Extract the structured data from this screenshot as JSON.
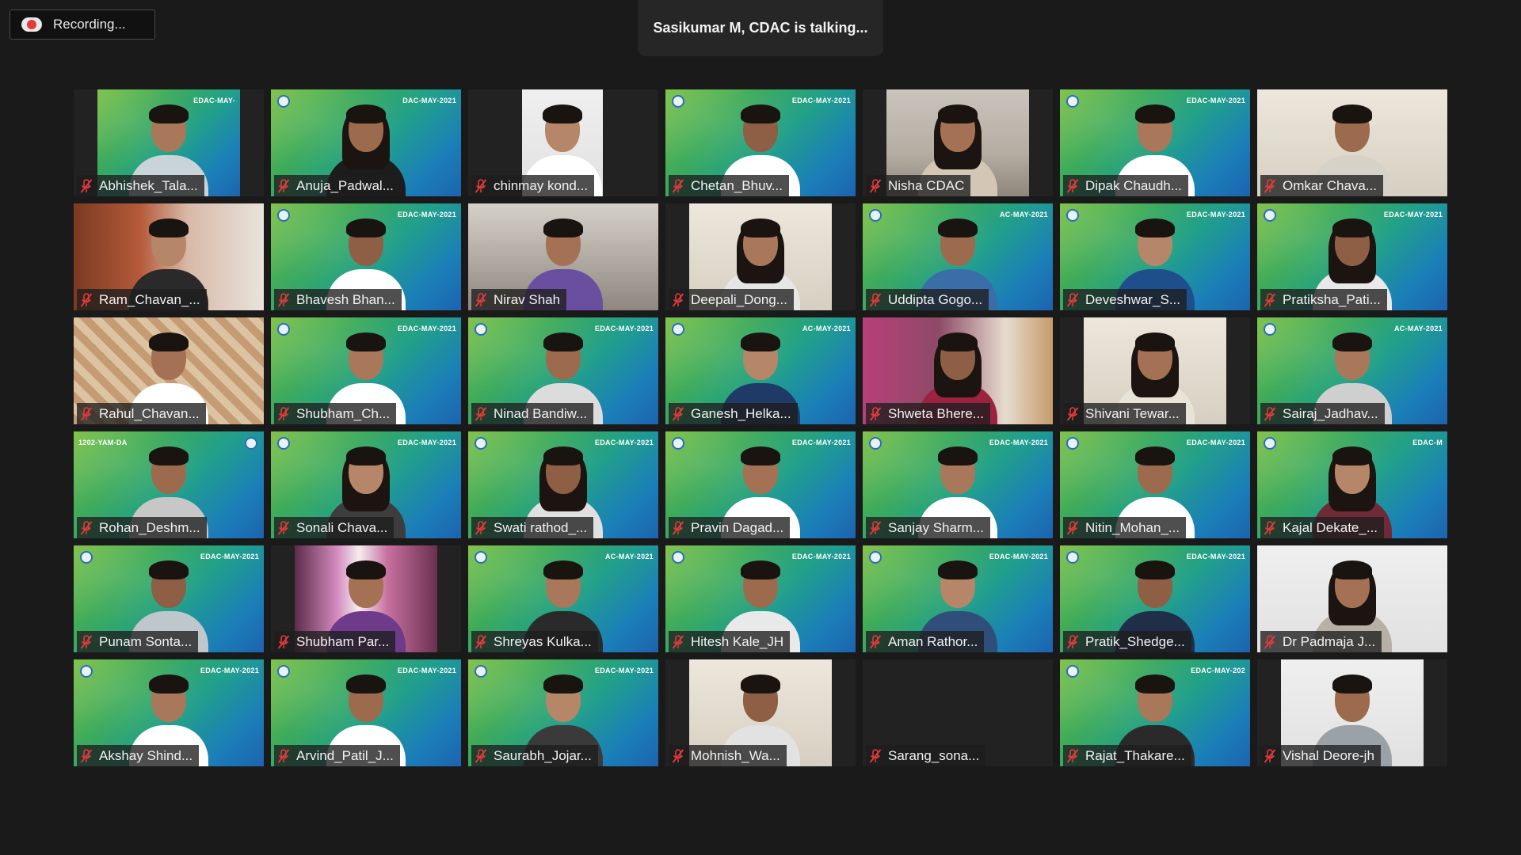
{
  "recording": {
    "label": "Recording..."
  },
  "talking": {
    "text": "Sasikumar M, CDAC is talking..."
  },
  "brand_text": "EDAC-MAY-2021",
  "colors": {
    "mic_muted": "#e23b3b",
    "background": "#1a1a1a"
  },
  "participants": [
    {
      "name": "Abhishek_Tala...",
      "bg": "green",
      "x": 30,
      "w": 180,
      "brand": "EDAC-MAY-",
      "logo": "none",
      "shirt": "#c9d4d8"
    },
    {
      "name": "Anuja_Padwal...",
      "bg": "green",
      "x": 0,
      "w": 240,
      "brand": "DAC-MAY-2021",
      "logo": "left",
      "shirt": "#1c1c1c",
      "hair": "long"
    },
    {
      "name": "chinmay kond...",
      "bg": "white",
      "x": 68,
      "w": 102,
      "brand": "",
      "logo": "none",
      "shirt": "#ffffff"
    },
    {
      "name": "Chetan_Bhuv...",
      "bg": "green",
      "x": 0,
      "w": 240,
      "brand": "EDAC-MAY-2021",
      "logo": "left",
      "shirt": "#ffffff"
    },
    {
      "name": "Nisha CDAC",
      "bg": "room",
      "x": 30,
      "w": 180,
      "brand": "",
      "logo": "none",
      "shirt": "#d3c6b4",
      "hair": "long"
    },
    {
      "name": "Dipak Chaudh...",
      "bg": "green",
      "x": 0,
      "w": 240,
      "brand": "EDAC-MAY-2021",
      "logo": "left",
      "shirt": "#ffffff"
    },
    {
      "name": "Omkar Chava...",
      "bg": "cream",
      "x": 0,
      "w": 240,
      "brand": "",
      "logo": "none",
      "shirt": "#d6d2c8"
    },
    {
      "name": "Ram_Chavan_...",
      "bg": "orange",
      "x": 0,
      "w": 240,
      "brand": "",
      "logo": "none",
      "shirt": "#2a2a2a"
    },
    {
      "name": "Bhavesh Bhan...",
      "bg": "green",
      "x": 0,
      "w": 240,
      "brand": "EDAC-MAY-2021",
      "logo": "left",
      "shirt": "#ffffff"
    },
    {
      "name": "Nirav Shah",
      "bg": "dark",
      "x": 0,
      "w": 240,
      "brand": "",
      "logo": "none",
      "shirt": "#6a4fa0"
    },
    {
      "name": "Deepali_Dong...",
      "bg": "cream",
      "x": 30,
      "w": 180,
      "brand": "",
      "logo": "none",
      "shirt": "#e6e6e6",
      "hair": "long"
    },
    {
      "name": "Uddipta Gogo...",
      "bg": "green",
      "x": 0,
      "w": 240,
      "brand": "AC-MAY-2021",
      "logo": "left",
      "shirt": "#3a6ea8"
    },
    {
      "name": "Deveshwar_S...",
      "bg": "green",
      "x": 0,
      "w": 240,
      "brand": "EDAC-MAY-2021",
      "logo": "left",
      "shirt": "#1e4f8c"
    },
    {
      "name": "Pratiksha_Pati...",
      "bg": "green",
      "x": 0,
      "w": 240,
      "brand": "EDAC-MAY-2021",
      "logo": "left",
      "shirt": "#e9e9e9",
      "hair": "long"
    },
    {
      "name": "Rahul_Chavan...",
      "bg": "pattern",
      "x": 0,
      "w": 240,
      "brand": "",
      "logo": "none",
      "shirt": "#ffffff"
    },
    {
      "name": "Shubham_Ch...",
      "bg": "green",
      "x": 0,
      "w": 240,
      "brand": "EDAC-MAY-2021",
      "logo": "left",
      "shirt": "#ffffff"
    },
    {
      "name": "Ninad Bandiw...",
      "bg": "green",
      "x": 0,
      "w": 240,
      "brand": "EDAC-MAY-2021",
      "logo": "left",
      "shirt": "#dcdcdc"
    },
    {
      "name": "Ganesh_Helka...",
      "bg": "green",
      "x": 0,
      "w": 240,
      "brand": "AC-MAY-2021",
      "logo": "left",
      "shirt": "#1f3a66"
    },
    {
      "name": "Shweta Bhere...",
      "bg": "pink",
      "x": 0,
      "w": 240,
      "brand": "",
      "logo": "none",
      "shirt": "#9b2340",
      "hair": "long"
    },
    {
      "name": "Shivani Tewar...",
      "bg": "cream",
      "x": 30,
      "w": 180,
      "brand": "",
      "logo": "none",
      "shirt": "#e9e4d8",
      "hair": "long"
    },
    {
      "name": "Sairaj_Jadhav...",
      "bg": "green",
      "x": 0,
      "w": 240,
      "brand": "AC-MAY-2021",
      "logo": "left",
      "shirt": "#cfcfcf"
    },
    {
      "name": "Rohan_Deshm...",
      "bg": "green",
      "x": 0,
      "w": 240,
      "brand": "1202-YAM-DA",
      "logo": "right",
      "shirt": "#c7c7c7"
    },
    {
      "name": "Sonali Chava...",
      "bg": "green",
      "x": 0,
      "w": 240,
      "brand": "EDAC-MAY-2021",
      "logo": "left",
      "shirt": "#3d3d3d",
      "hair": "long"
    },
    {
      "name": "Swati rathod_...",
      "bg": "green",
      "x": 0,
      "w": 240,
      "brand": "EDAC-MAY-2021",
      "logo": "left",
      "shirt": "#e0e0e0",
      "hair": "long"
    },
    {
      "name": "Pravin Dagad...",
      "bg": "green",
      "x": 0,
      "w": 240,
      "brand": "EDAC-MAY-2021",
      "logo": "left",
      "shirt": "#ffffff"
    },
    {
      "name": "Sanjay Sharm...",
      "bg": "green",
      "x": 0,
      "w": 240,
      "brand": "EDAC-MAY-2021",
      "logo": "left",
      "shirt": "#ffffff"
    },
    {
      "name": "Nitin_Mohan_...",
      "bg": "green",
      "x": 0,
      "w": 240,
      "brand": "EDAC-MAY-2021",
      "logo": "left",
      "shirt": "#ffffff"
    },
    {
      "name": "Kajal Dekate_...",
      "bg": "green",
      "x": 0,
      "w": 240,
      "brand": "EDAC-M",
      "logo": "left",
      "shirt": "#6f2a36",
      "hair": "long"
    },
    {
      "name": "Punam Sonta...",
      "bg": "green",
      "x": 0,
      "w": 240,
      "brand": "EDAC-MAY-2021",
      "logo": "left",
      "shirt": "#bfc6cc"
    },
    {
      "name": "Shubham Par...",
      "bg": "curtain",
      "x": 30,
      "w": 180,
      "brand": "",
      "logo": "none",
      "shirt": "#6e3b8a"
    },
    {
      "name": "Shreyas Kulka...",
      "bg": "green",
      "x": 0,
      "w": 240,
      "brand": "AC-MAY-2021",
      "logo": "left",
      "shirt": "#2a2a2a"
    },
    {
      "name": "Hitesh Kale_JH",
      "bg": "green",
      "x": 0,
      "w": 240,
      "brand": "EDAC-MAY-2021",
      "logo": "left",
      "shirt": "#e9e9e9"
    },
    {
      "name": "Aman Rathor...",
      "bg": "green",
      "x": 0,
      "w": 240,
      "brand": "EDAC-MAY-2021",
      "logo": "left",
      "shirt": "#2f4f7a"
    },
    {
      "name": "Pratik_Shedge...",
      "bg": "green",
      "x": 0,
      "w": 240,
      "brand": "EDAC-MAY-2021",
      "logo": "left",
      "shirt": "#1f2f4a"
    },
    {
      "name": "Dr Padmaja J...",
      "bg": "white",
      "x": 0,
      "w": 240,
      "brand": "",
      "logo": "none",
      "shirt": "#b7b0a4",
      "hair": "long"
    },
    {
      "name": "Akshay Shind...",
      "bg": "green",
      "x": 0,
      "w": 240,
      "brand": "EDAC-MAY-2021",
      "logo": "left",
      "shirt": "#ffffff"
    },
    {
      "name": "Arvind_Patil_J...",
      "bg": "green",
      "x": 0,
      "w": 240,
      "brand": "EDAC-MAY-2021",
      "logo": "left",
      "shirt": "#ffffff"
    },
    {
      "name": "Saurabh_Jojar...",
      "bg": "green",
      "x": 0,
      "w": 240,
      "brand": "EDAC-MAY-2021",
      "logo": "left",
      "shirt": "#3a3a3a"
    },
    {
      "name": "Mohnish_Wa...",
      "bg": "cream",
      "x": 30,
      "w": 180,
      "brand": "",
      "logo": "none",
      "shirt": "#e2e2e2"
    },
    {
      "name": "Sarang_sona...",
      "bg": "none",
      "x": 0,
      "w": 240,
      "brand": "",
      "logo": "none",
      "shirt": "",
      "empty": true
    },
    {
      "name": "Rajat_Thakare...",
      "bg": "green",
      "x": 0,
      "w": 240,
      "brand": "EDAC-MAY-202",
      "logo": "left",
      "shirt": "#2a2a2a"
    },
    {
      "name": "Vishal Deore-jh",
      "bg": "white",
      "x": 30,
      "w": 180,
      "brand": "",
      "logo": "none",
      "shirt": "#9aa2a8"
    }
  ]
}
